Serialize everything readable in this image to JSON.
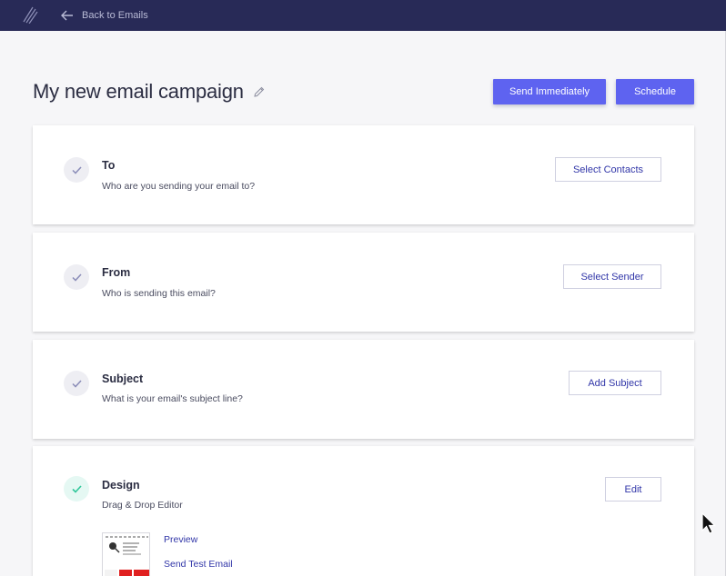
{
  "topbar": {
    "logo_icon": "brand-logo-icon",
    "back_label": "Back to Emails",
    "back_icon": "arrow-left-icon",
    "background": "#282a57"
  },
  "header": {
    "title": "My new email campaign",
    "edit_icon": "pencil-icon",
    "send_label": "Send Immediately",
    "schedule_label": "Schedule",
    "accent": "#5e63f0"
  },
  "steps": [
    {
      "title": "To",
      "subtitle": "Who are you sending your email to?",
      "action": "Select Contacts",
      "status": "incomplete"
    },
    {
      "title": "From",
      "subtitle": "Who is sending this email?",
      "action": "Select Sender",
      "status": "incomplete"
    },
    {
      "title": "Subject",
      "subtitle": "What is your email's subject line?",
      "action": "Add Subject",
      "status": "incomplete"
    },
    {
      "title": "Design",
      "subtitle": "Drag & Drop Editor",
      "action": "Edit",
      "status": "complete",
      "preview_label": "Preview",
      "test_label": "Send Test Email"
    }
  ],
  "colors": {
    "check_incomplete": "#8a8cb8",
    "check_complete": "#2fc79a",
    "link": "#3136a8"
  }
}
